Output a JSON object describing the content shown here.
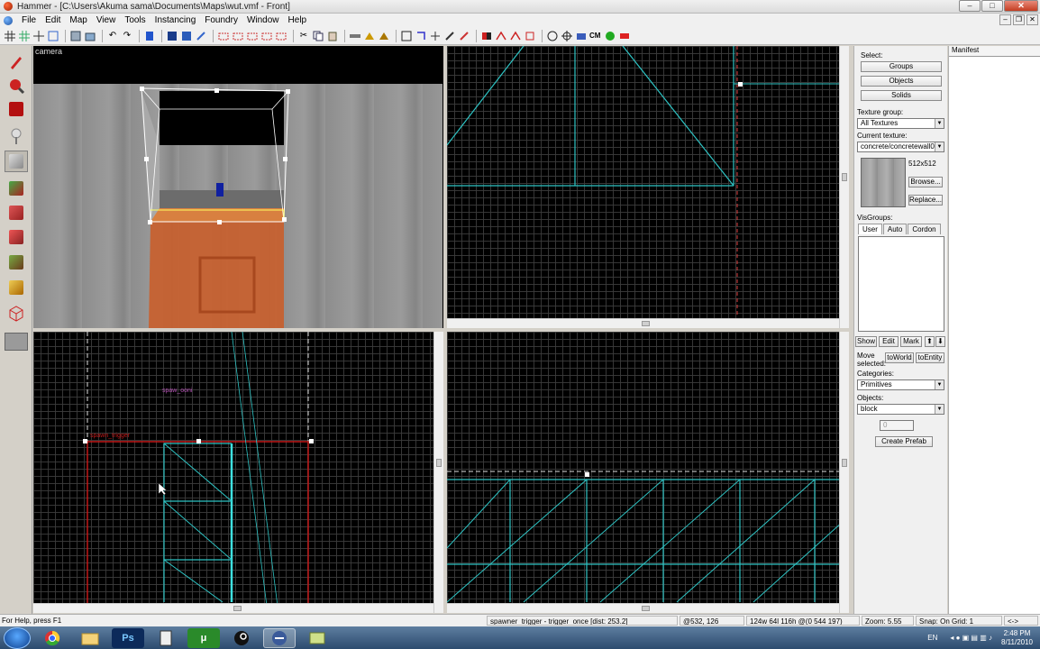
{
  "window": {
    "title": "Hammer - [C:\\Users\\Akuma sama\\Documents\\Maps\\wut.vmf - Front]",
    "minimize": "–",
    "maximize": "□",
    "close": "✕"
  },
  "menu": [
    "File",
    "Edit",
    "Map",
    "View",
    "Tools",
    "Instancing",
    "Foundry",
    "Window",
    "Help"
  ],
  "toolbar": {
    "cm_label": "CM"
  },
  "viewports": {
    "camera": {
      "label": "camera"
    },
    "top_right": {},
    "bottom_left": {
      "entity_label": "spaw_ooni",
      "trigger_label": "spawn_trigger"
    },
    "bottom_right": {}
  },
  "panel": {
    "select_label": "Select:",
    "groups_btn": "Groups",
    "objects_btn": "Objects",
    "solids_btn": "Solids",
    "texture_group_label": "Texture group:",
    "texture_group_value": "All Textures",
    "current_texture_label": "Current texture:",
    "current_texture_value": "concrete/concretewall0",
    "texture_size": "512x512",
    "browse_btn": "Browse...",
    "replace_btn": "Replace...",
    "visgroups_label": "VisGroups:",
    "visgroup_tabs": [
      "User",
      "Auto",
      "Cordon"
    ],
    "show_btn": "Show",
    "edit_btn": "Edit",
    "mark_btn": "Mark",
    "up_btn": "⬆",
    "down_btn": "⬇",
    "move_selected_label1": "Move",
    "move_selected_label2": "selected:",
    "to_world_btn": "toWorld",
    "to_entity_btn": "toEntity",
    "categories_label": "Categories:",
    "categories_value": "Primitives",
    "objects_label": "Objects:",
    "objects_value": "block",
    "faces_value": "0",
    "create_prefab_btn": "Create Prefab"
  },
  "manifest": {
    "title": "Manifest"
  },
  "status": {
    "help": "For Help, press F1",
    "selection": "spawner_trigger - trigger_once   [dist: 253.2]",
    "coords": "@532, 126",
    "size": "124w 64l 116h @(0 544 197)",
    "zoom": "Zoom: 5.55",
    "snap": "Snap: On Grid: 1",
    "nav": "<->"
  },
  "taskbar": {
    "ps_label": "Ps",
    "utorrent_label": "μ",
    "lang": "EN",
    "time": "2:48 PM",
    "date": "8/11/2010"
  },
  "colors": {
    "grid_wire": "#2ec4c4",
    "trigger_red": "#c01818",
    "selection_orange": "#d0602a",
    "viewport_bg": "#000000"
  }
}
